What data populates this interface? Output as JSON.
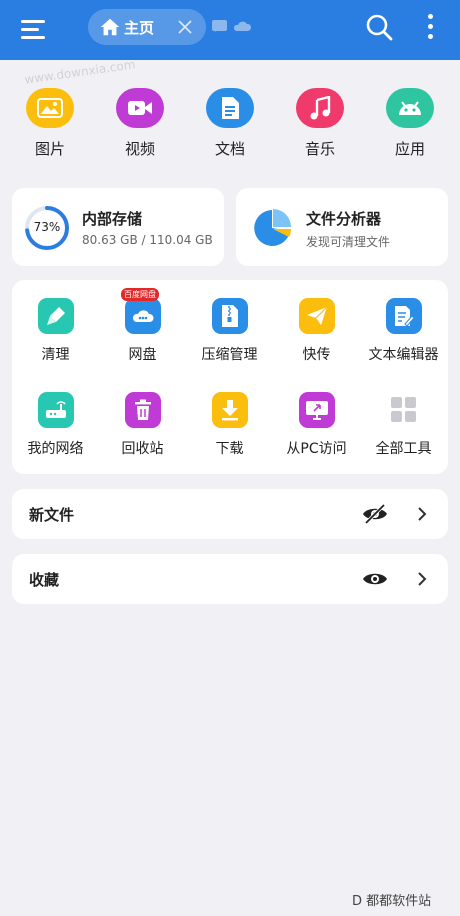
{
  "header": {
    "tab_label": "主页",
    "icons": [
      "menu-icon",
      "home-icon",
      "close-icon",
      "cast-icon",
      "cloud-icon",
      "search-icon",
      "more-vertical-icon"
    ],
    "background": "#2a7de1"
  },
  "watermark": "www.downxia.com",
  "categories": [
    {
      "label": "图片",
      "icon": "image-icon",
      "color": "#fbbe0c"
    },
    {
      "label": "视频",
      "icon": "video-icon",
      "color": "#c03ad6"
    },
    {
      "label": "文档",
      "icon": "document-icon",
      "color": "#2a8de6"
    },
    {
      "label": "音乐",
      "icon": "music-icon",
      "color": "#ef3a6b"
    },
    {
      "label": "应用",
      "icon": "android-icon",
      "color": "#2ec5a0"
    }
  ],
  "storage": {
    "title": "内部存储",
    "percent_label": "73%",
    "used_fraction": 0.73,
    "detail": "80.63 GB / 110.04 GB"
  },
  "analyzer": {
    "title": "文件分析器",
    "subtitle": "发现可清理文件"
  },
  "tools": [
    {
      "label": "清理",
      "icon": "broom-icon",
      "color": "#27c7b2"
    },
    {
      "label": "网盘",
      "icon": "cloud-drive-icon",
      "color": "#2a8de6",
      "badge": "百度网盘"
    },
    {
      "label": "压缩管理",
      "icon": "zip-icon",
      "color": "#2a8de6"
    },
    {
      "label": "快传",
      "icon": "send-icon",
      "color": "#fbbe0c"
    },
    {
      "label": "文本编辑器",
      "icon": "text-edit-icon",
      "color": "#2a8de6"
    },
    {
      "label": "我的网络",
      "icon": "router-icon",
      "color": "#27c7b2"
    },
    {
      "label": "回收站",
      "icon": "trash-icon",
      "color": "#c03ad6"
    },
    {
      "label": "下载",
      "icon": "download-icon",
      "color": "#fbbe0c"
    },
    {
      "label": "从PC访问",
      "icon": "pc-access-icon",
      "color": "#c03ad6"
    },
    {
      "label": "全部工具",
      "icon": "grid-icon",
      "color": "#c9c9cf"
    }
  ],
  "sections": [
    {
      "label": "新文件",
      "eye": "eye-off-icon"
    },
    {
      "label": "收藏",
      "eye": "eye-icon"
    }
  ],
  "footer_watermark": "D 都都软件站"
}
